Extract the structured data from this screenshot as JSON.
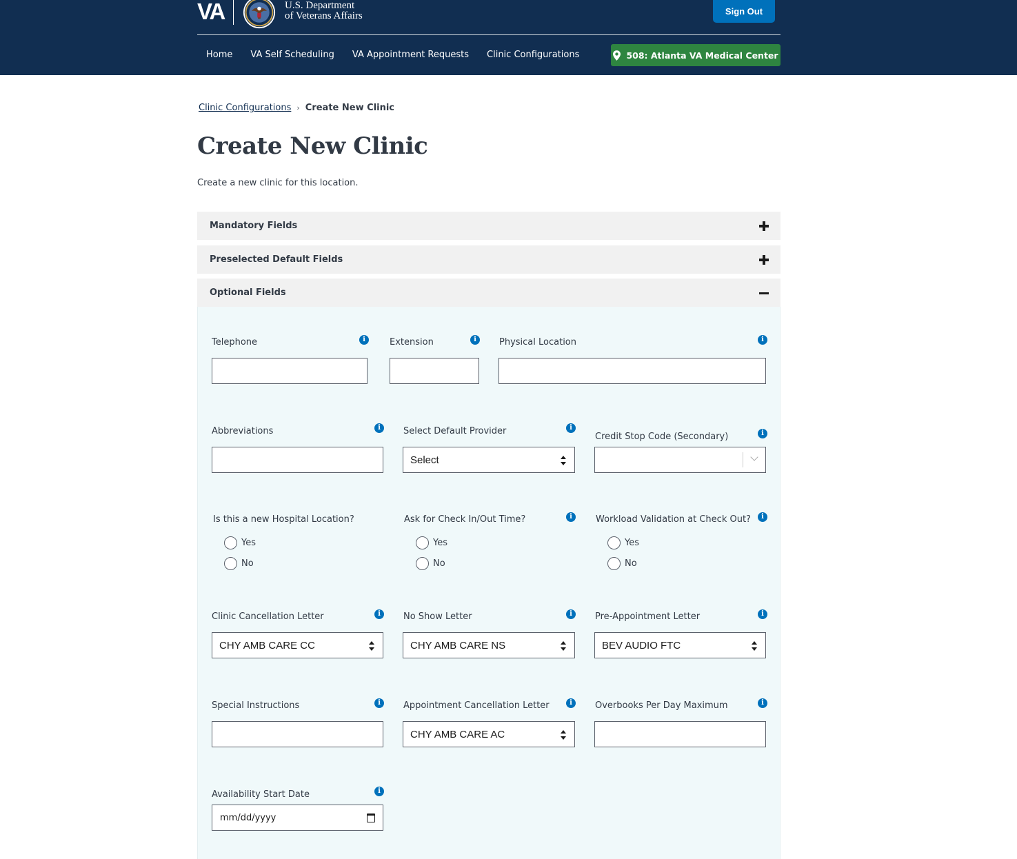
{
  "header": {
    "logo_text": "VA",
    "department_line1": "U.S. Department",
    "department_line2": "of Veterans Affairs",
    "sign_out_label": "Sign Out",
    "nav": [
      "Home",
      "VA Self Scheduling",
      "VA Appointment Requests",
      "Clinic Configurations"
    ],
    "facility_label": "508: Atlanta VA Medical Center"
  },
  "breadcrumb": {
    "parent": "Clinic Configurations",
    "separator": "›",
    "current": "Create New Clinic"
  },
  "page": {
    "title": "Create New Clinic",
    "subtitle": "Create a new clinic for this location."
  },
  "accordions": {
    "mandatory": "Mandatory Fields",
    "preselected": "Preselected Default Fields",
    "optional": "Optional Fields"
  },
  "form": {
    "telephone_label": "Telephone",
    "extension_label": "Extension",
    "physical_location_label": "Physical Location",
    "abbreviations_label": "Abbreviations",
    "default_provider_label": "Select Default Provider",
    "default_provider_value": "Select",
    "credit_stop_code_label": "Credit Stop Code (Secondary)",
    "hospital_location_label": "Is this a new Hospital Location?",
    "check_in_out_label": "Ask for Check In/Out Time?",
    "workload_validation_label": "Workload Validation at Check Out?",
    "yes_label": "Yes",
    "no_label": "No",
    "clinic_cancellation_label": "Clinic Cancellation Letter",
    "clinic_cancellation_value": "CHY AMB CARE CC",
    "no_show_label": "No Show Letter",
    "no_show_value": "CHY AMB CARE NS",
    "pre_appointment_label": "Pre-Appointment Letter",
    "pre_appointment_value": "BEV AUDIO FTC",
    "special_instructions_label": "Special Instructions",
    "appointment_cancellation_label": "Appointment Cancellation Letter",
    "appointment_cancellation_value": "CHY AMB CARE AC",
    "overbooks_label": "Overbooks Per Day Maximum",
    "availability_start_label": "Availability Start Date",
    "availability_start_placeholder": "mm/dd/yyyy",
    "info_glyph": "i"
  },
  "colors": {
    "header_bg": "#112e51",
    "primary_blue": "#0071bb",
    "facility_green": "#2e8540",
    "accordion_bg": "#f1f1f1",
    "panel_bg": "#f0f9fa"
  }
}
